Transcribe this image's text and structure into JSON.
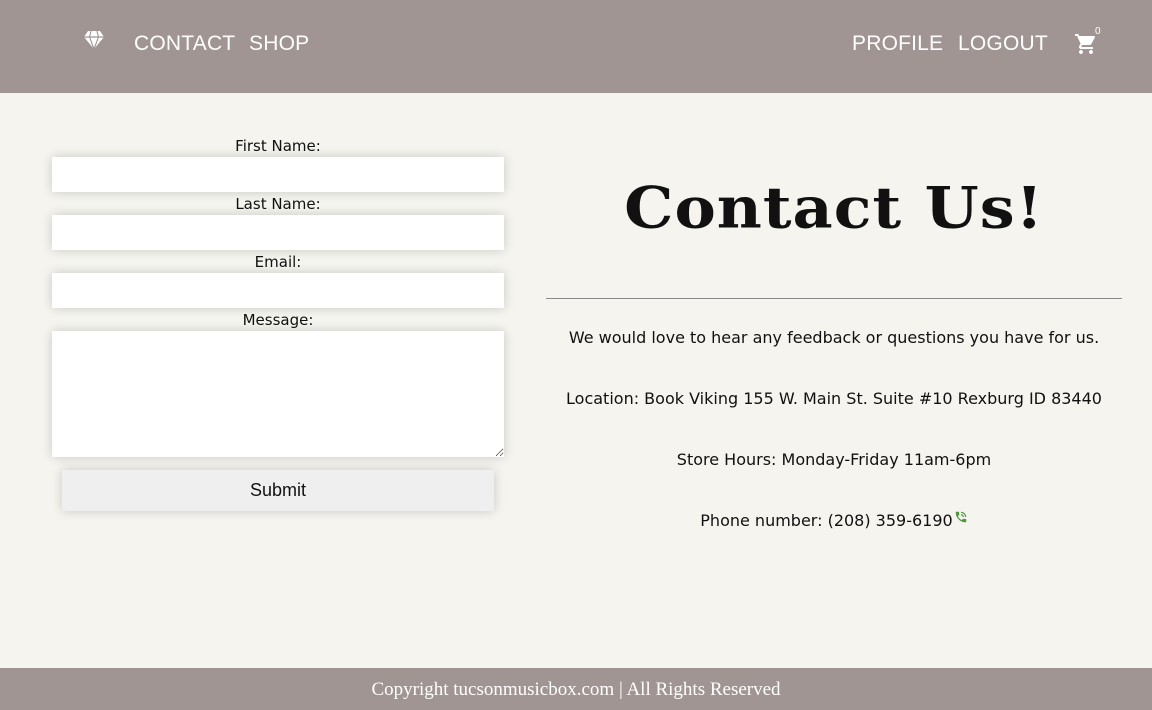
{
  "nav": {
    "logo_icon": "diamond-icon",
    "contact_label": "CONTACT",
    "shop_label": "SHOP",
    "profile_label": "PROFILE",
    "logout_label": "LOGOUT",
    "cart_icon": "shopping-cart-icon",
    "cart_count": "0"
  },
  "form": {
    "first_name_label": "First Name:",
    "first_name_value": "",
    "last_name_label": "Last Name:",
    "last_name_value": "",
    "email_label": "Email:",
    "email_value": "",
    "message_label": "Message:",
    "message_value": "",
    "submit_label": "Submit"
  },
  "info": {
    "heading": "Contact Us!",
    "intro": "We would love to hear any feedback or questions you have for us.",
    "location": "Location: Book Viking 155 W. Main St. Suite #10 Rexburg ID 83440",
    "hours": "Store Hours: Monday-Friday 11am-6pm",
    "phone": "Phone number: (208) 359-6190",
    "phone_icon": "phone-icon"
  },
  "footer": {
    "text": "Copyright tucsonmusicbox.com | All Rights Reserved"
  },
  "colors": {
    "nav_background": "#a19593",
    "page_background": "#f5f4ef",
    "phone_icon": "#4a9a3a"
  }
}
